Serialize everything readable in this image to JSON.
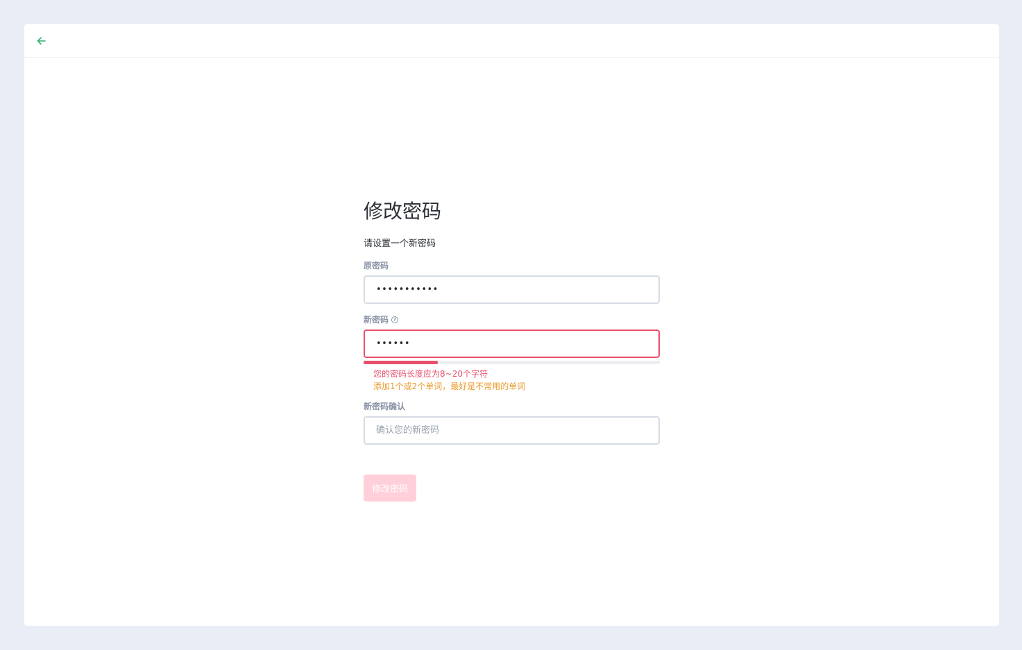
{
  "header": {
    "back_icon": "arrow-left-icon",
    "accent_color": "#2fb36b"
  },
  "form": {
    "title": "修改密码",
    "subtitle": "请设置一个新密码",
    "old_password": {
      "label": "原密码",
      "value": "•••••••••••"
    },
    "new_password": {
      "label": "新密码",
      "help_icon": "question-circle-icon",
      "value": "••••••",
      "strength_fraction": 0.25,
      "strength_color": "#e9506d",
      "errors": [
        "您的密码长度应为8~20个字符",
        "添加1个或2个单词，最好是不常用的单词"
      ]
    },
    "confirm_password": {
      "label": "新密码确认",
      "placeholder": "确认您的新密码"
    },
    "submit_label": "修改密码"
  }
}
